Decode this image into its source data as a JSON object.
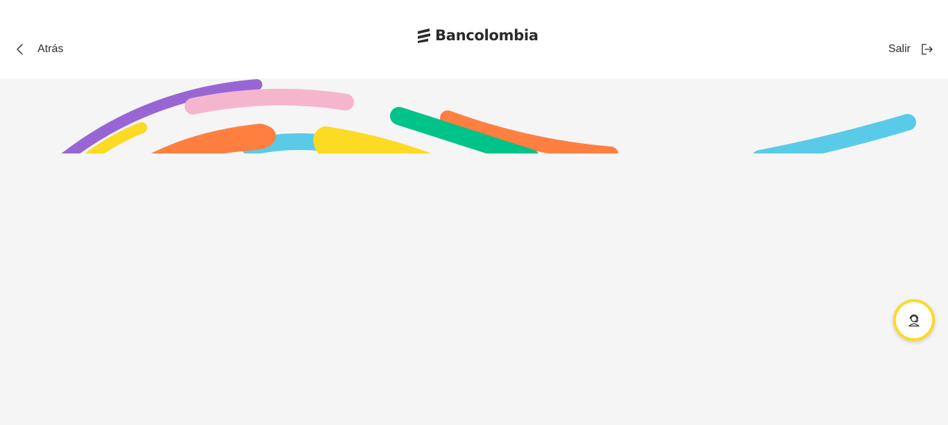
{
  "header": {
    "back_label": "Atrás",
    "back_icon": "chevron-left-icon",
    "brand_name": "Bancolombia",
    "brand_icon": "bancolombia-logo-icon",
    "exit_label": "Salir",
    "exit_icon": "logout-icon"
  },
  "hero": {
    "decoration": "colorful-brushstrokes",
    "colors": {
      "purple": "#9866d4",
      "pink": "#f5b6cd",
      "yellow": "#fdda24",
      "orange": "#ff7f41",
      "blue": "#59cbe8",
      "green": "#00c389"
    }
  },
  "help_button": {
    "icon": "user-support-icon",
    "border_color": "#fdda24"
  },
  "colors": {
    "header_bg": "#ffffff",
    "page_bg": "#f5f5f5",
    "text": "#2c2a29"
  }
}
